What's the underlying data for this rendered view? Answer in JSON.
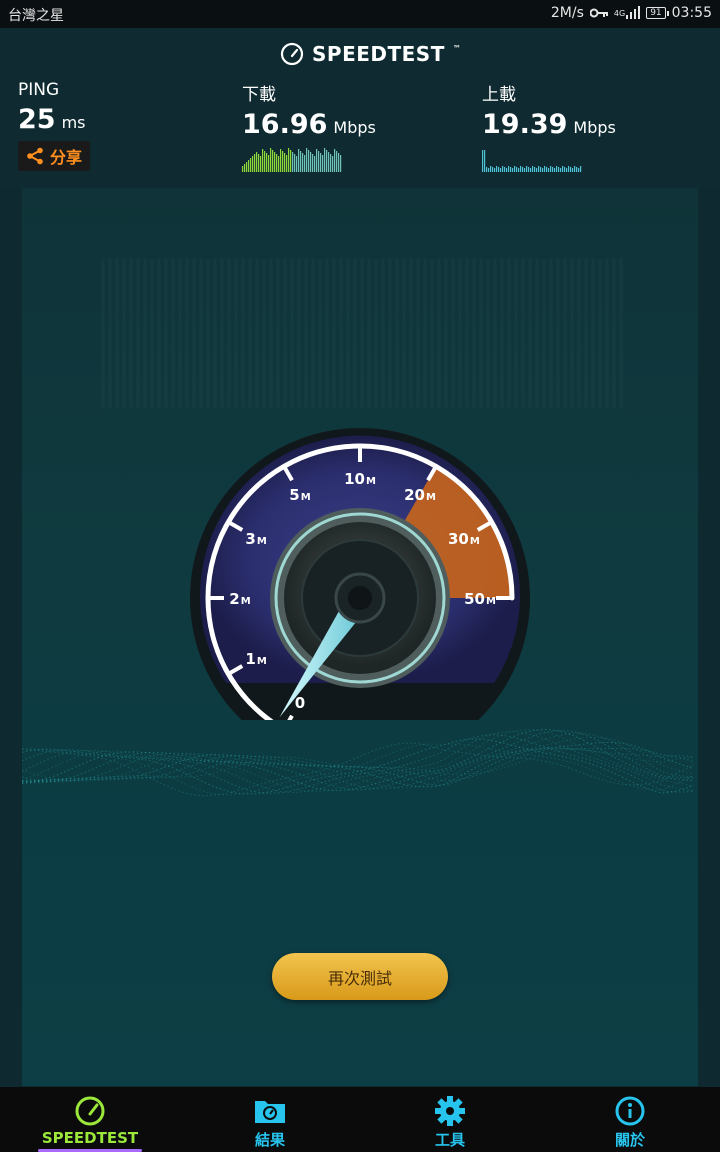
{
  "status_bar": {
    "carrier": "台灣之星",
    "speed": "2M/s",
    "network": "4G",
    "battery": "91",
    "time": "03:55"
  },
  "header": {
    "brand": "SPEEDTEST",
    "trademark": "™"
  },
  "results": {
    "ping": {
      "label": "PING",
      "value": "25",
      "unit": "ms"
    },
    "download": {
      "label": "下載",
      "value": "16.96",
      "unit": "Mbps"
    },
    "upload": {
      "label": "上載",
      "value": "19.39",
      "unit": "Mbps"
    },
    "share_label": "分享"
  },
  "gauge": {
    "ticks": [
      {
        "main": "0",
        "sub": ""
      },
      {
        "main": "1",
        "sub": "M"
      },
      {
        "main": "2",
        "sub": "M"
      },
      {
        "main": "3",
        "sub": "M"
      },
      {
        "main": "5",
        "sub": "M"
      },
      {
        "main": "10",
        "sub": "M"
      },
      {
        "main": "20",
        "sub": "M"
      },
      {
        "main": "30",
        "sub": "M"
      },
      {
        "main": "50",
        "sub": "M"
      }
    ],
    "colors": {
      "ring": "#ffffff",
      "inner": "#6f56d6",
      "high_zone": "#e07a1e",
      "needle": "#7de8f2"
    }
  },
  "again_button": "再次測試",
  "bottom_nav": [
    {
      "label": "SPEEDTEST",
      "icon": "speedometer-icon",
      "color": "#9be83b",
      "active": true
    },
    {
      "label": "結果",
      "icon": "results-folder-icon",
      "color": "#27c4ee",
      "active": false
    },
    {
      "label": "工具",
      "icon": "gear-icon",
      "color": "#27c4ee",
      "active": false
    },
    {
      "label": "關於",
      "icon": "info-icon",
      "color": "#27c4ee",
      "active": false
    }
  ]
}
